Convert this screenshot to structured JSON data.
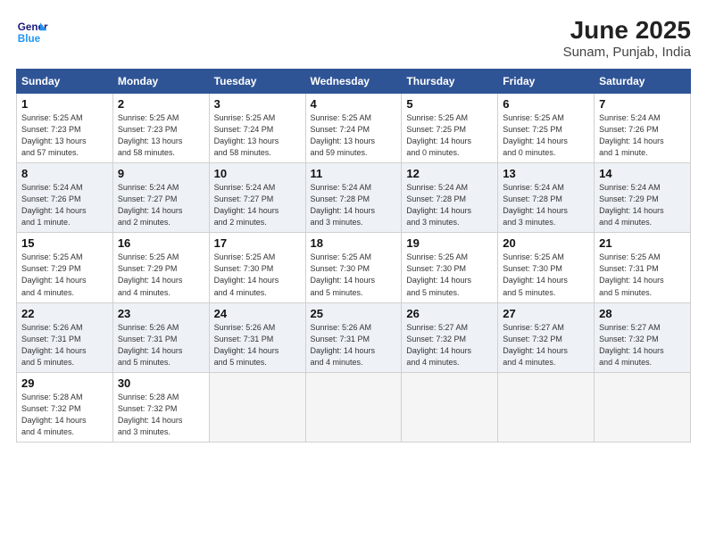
{
  "header": {
    "logo_line1": "General",
    "logo_line2": "Blue",
    "title": "June 2025",
    "subtitle": "Sunam, Punjab, India"
  },
  "days_of_week": [
    "Sunday",
    "Monday",
    "Tuesday",
    "Wednesday",
    "Thursday",
    "Friday",
    "Saturday"
  ],
  "weeks": [
    [
      {
        "day": "1",
        "info": "Sunrise: 5:25 AM\nSunset: 7:23 PM\nDaylight: 13 hours\nand 57 minutes."
      },
      {
        "day": "2",
        "info": "Sunrise: 5:25 AM\nSunset: 7:23 PM\nDaylight: 13 hours\nand 58 minutes."
      },
      {
        "day": "3",
        "info": "Sunrise: 5:25 AM\nSunset: 7:24 PM\nDaylight: 13 hours\nand 58 minutes."
      },
      {
        "day": "4",
        "info": "Sunrise: 5:25 AM\nSunset: 7:24 PM\nDaylight: 13 hours\nand 59 minutes."
      },
      {
        "day": "5",
        "info": "Sunrise: 5:25 AM\nSunset: 7:25 PM\nDaylight: 14 hours\nand 0 minutes."
      },
      {
        "day": "6",
        "info": "Sunrise: 5:25 AM\nSunset: 7:25 PM\nDaylight: 14 hours\nand 0 minutes."
      },
      {
        "day": "7",
        "info": "Sunrise: 5:24 AM\nSunset: 7:26 PM\nDaylight: 14 hours\nand 1 minute."
      }
    ],
    [
      {
        "day": "8",
        "info": "Sunrise: 5:24 AM\nSunset: 7:26 PM\nDaylight: 14 hours\nand 1 minute."
      },
      {
        "day": "9",
        "info": "Sunrise: 5:24 AM\nSunset: 7:27 PM\nDaylight: 14 hours\nand 2 minutes."
      },
      {
        "day": "10",
        "info": "Sunrise: 5:24 AM\nSunset: 7:27 PM\nDaylight: 14 hours\nand 2 minutes."
      },
      {
        "day": "11",
        "info": "Sunrise: 5:24 AM\nSunset: 7:28 PM\nDaylight: 14 hours\nand 3 minutes."
      },
      {
        "day": "12",
        "info": "Sunrise: 5:24 AM\nSunset: 7:28 PM\nDaylight: 14 hours\nand 3 minutes."
      },
      {
        "day": "13",
        "info": "Sunrise: 5:24 AM\nSunset: 7:28 PM\nDaylight: 14 hours\nand 3 minutes."
      },
      {
        "day": "14",
        "info": "Sunrise: 5:24 AM\nSunset: 7:29 PM\nDaylight: 14 hours\nand 4 minutes."
      }
    ],
    [
      {
        "day": "15",
        "info": "Sunrise: 5:25 AM\nSunset: 7:29 PM\nDaylight: 14 hours\nand 4 minutes."
      },
      {
        "day": "16",
        "info": "Sunrise: 5:25 AM\nSunset: 7:29 PM\nDaylight: 14 hours\nand 4 minutes."
      },
      {
        "day": "17",
        "info": "Sunrise: 5:25 AM\nSunset: 7:30 PM\nDaylight: 14 hours\nand 4 minutes."
      },
      {
        "day": "18",
        "info": "Sunrise: 5:25 AM\nSunset: 7:30 PM\nDaylight: 14 hours\nand 5 minutes."
      },
      {
        "day": "19",
        "info": "Sunrise: 5:25 AM\nSunset: 7:30 PM\nDaylight: 14 hours\nand 5 minutes."
      },
      {
        "day": "20",
        "info": "Sunrise: 5:25 AM\nSunset: 7:30 PM\nDaylight: 14 hours\nand 5 minutes."
      },
      {
        "day": "21",
        "info": "Sunrise: 5:25 AM\nSunset: 7:31 PM\nDaylight: 14 hours\nand 5 minutes."
      }
    ],
    [
      {
        "day": "22",
        "info": "Sunrise: 5:26 AM\nSunset: 7:31 PM\nDaylight: 14 hours\nand 5 minutes."
      },
      {
        "day": "23",
        "info": "Sunrise: 5:26 AM\nSunset: 7:31 PM\nDaylight: 14 hours\nand 5 minutes."
      },
      {
        "day": "24",
        "info": "Sunrise: 5:26 AM\nSunset: 7:31 PM\nDaylight: 14 hours\nand 5 minutes."
      },
      {
        "day": "25",
        "info": "Sunrise: 5:26 AM\nSunset: 7:31 PM\nDaylight: 14 hours\nand 4 minutes."
      },
      {
        "day": "26",
        "info": "Sunrise: 5:27 AM\nSunset: 7:32 PM\nDaylight: 14 hours\nand 4 minutes."
      },
      {
        "day": "27",
        "info": "Sunrise: 5:27 AM\nSunset: 7:32 PM\nDaylight: 14 hours\nand 4 minutes."
      },
      {
        "day": "28",
        "info": "Sunrise: 5:27 AM\nSunset: 7:32 PM\nDaylight: 14 hours\nand 4 minutes."
      }
    ],
    [
      {
        "day": "29",
        "info": "Sunrise: 5:28 AM\nSunset: 7:32 PM\nDaylight: 14 hours\nand 4 minutes."
      },
      {
        "day": "30",
        "info": "Sunrise: 5:28 AM\nSunset: 7:32 PM\nDaylight: 14 hours\nand 3 minutes."
      },
      {
        "day": "",
        "info": ""
      },
      {
        "day": "",
        "info": ""
      },
      {
        "day": "",
        "info": ""
      },
      {
        "day": "",
        "info": ""
      },
      {
        "day": "",
        "info": ""
      }
    ]
  ]
}
